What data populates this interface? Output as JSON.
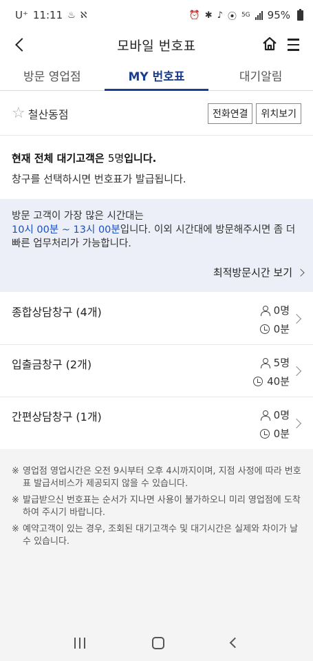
{
  "status_bar": {
    "carrier": "U⁺",
    "time": "11:11",
    "battery": "95%",
    "network": "5G"
  },
  "header": {
    "title": "모바일 번호표"
  },
  "tabs": [
    {
      "label": "방문 영업점",
      "active": false
    },
    {
      "label": "MY 번호표",
      "active": true
    },
    {
      "label": "대기알림",
      "active": false
    }
  ],
  "branch": {
    "name": "철산동점",
    "call_button": "전화연결",
    "location_button": "위치보기"
  },
  "wait_info": {
    "prefix": "현재 전체 대기고객은 ",
    "count": "5명",
    "suffix": "입니다.",
    "instruction": "창구를 선택하시면 번호표가 발급됩니다."
  },
  "notice": {
    "line1": "방문 고객이 가장 많은 시간대는",
    "time_range": "10시 00분 ~ 13시 00분",
    "line2_rest": "입니다. 이외 시간대에 방문해주시면 좀 더 빠른 업무처리가 가능합니다.",
    "link": "최적방문시간 보기"
  },
  "counters": [
    {
      "name": "종합상담창구 (4개)",
      "people": "0명",
      "time": "0분"
    },
    {
      "name": "입출금창구 (2개)",
      "people": "5명",
      "time": "40분"
    },
    {
      "name": "간편상담창구 (1개)",
      "people": "0명",
      "time": "0분"
    }
  ],
  "footnotes": [
    {
      "mark": "※",
      "text": "영업점 영업시간은 오전 9시부터 오후 4시까지이며, 지점 사정에 따라 번호표 발급서비스가 제공되지 않을 수 있습니다."
    },
    {
      "mark": "※",
      "text": "발급받으신 번호표는 순서가 지나면 사용이 불가하오니 미리 영업점에 도착하여 주시기 바랍니다."
    },
    {
      "mark": "※",
      "text": "예약고객이 있는 경우, 조회된 대기고객수 및 대기시간은 실제와 차이가 날 수 있습니다."
    }
  ],
  "colors": {
    "accent": "#1a3d8f",
    "time_highlight": "#1a4fbf",
    "notice_bg": "#eceff7"
  }
}
